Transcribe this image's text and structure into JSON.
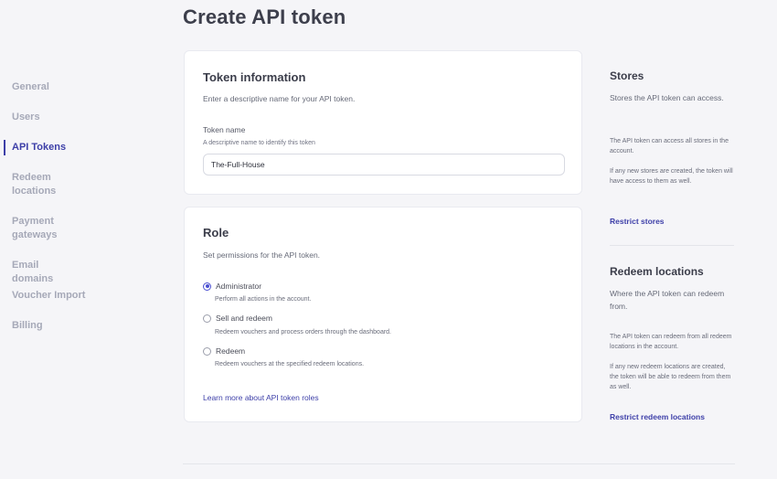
{
  "page": {
    "title": "Create API token"
  },
  "sidebar": {
    "items": [
      {
        "label": "General",
        "active": false
      },
      {
        "label": "Users",
        "active": false
      },
      {
        "label": "API Tokens",
        "active": true
      },
      {
        "label": "Redeem locations",
        "active": false
      },
      {
        "label": "Payment gateways",
        "active": false
      },
      {
        "label": "Email domains",
        "active": false
      },
      {
        "label": "Voucher Import",
        "active": false
      },
      {
        "label": "Billing",
        "active": false
      }
    ]
  },
  "token_info": {
    "title": "Token information",
    "subtitle": "Enter a descriptive name for your API token.",
    "name_label": "Token name",
    "name_help": "A descriptive name to identify this token",
    "name_value": "The-Full-House"
  },
  "role": {
    "title": "Role",
    "subtitle": "Set permissions for the API token.",
    "options": [
      {
        "label": "Administrator",
        "description": "Perform all actions in the account.",
        "checked": true
      },
      {
        "label": "Sell and redeem",
        "description": "Redeem vouchers and process orders through the dashboard.",
        "checked": false
      },
      {
        "label": "Redeem",
        "description": "Redeem vouchers at the specified redeem locations.",
        "checked": false
      }
    ],
    "learn_more": "Learn more about API token roles"
  },
  "stores": {
    "title": "Stores",
    "subtitle": "Stores the API token can access.",
    "note1": "The API token can access all stores in the account.",
    "note2": "If any new stores are created, the token will have access to them as well.",
    "link": "Restrict stores"
  },
  "redeem_locations": {
    "title": "Redeem locations",
    "subtitle": "Where the API token can redeem from.",
    "note1": "The API token can redeem from all redeem locations in the account.",
    "note2": "If any new redeem locations are created, the token will be able to redeem from them as well.",
    "link": "Restrict redeem locations"
  },
  "colors": {
    "accent": "#3d3fa8",
    "radio_accent": "#4a4fd1",
    "background": "#f5f5f8"
  }
}
